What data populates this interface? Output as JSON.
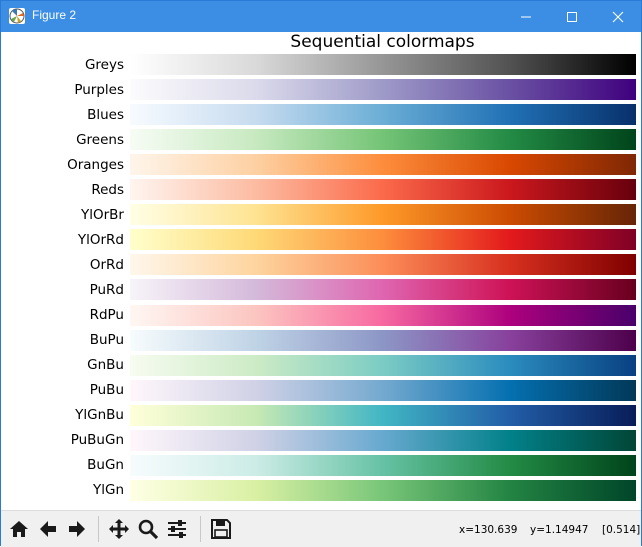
{
  "window": {
    "title": "Figure 2"
  },
  "figure": {
    "title": "Sequential colormaps"
  },
  "colormaps": [
    {
      "name": "Greys",
      "colors": [
        "#ffffff",
        "#d9d9d9",
        "#969696",
        "#525252",
        "#000000"
      ]
    },
    {
      "name": "Purples",
      "colors": [
        "#fcfbfd",
        "#dadaeb",
        "#9e9ac8",
        "#6a51a3",
        "#3f007d"
      ]
    },
    {
      "name": "Blues",
      "colors": [
        "#f7fbff",
        "#c6dbef",
        "#6baed6",
        "#2171b5",
        "#08306b"
      ]
    },
    {
      "name": "Greens",
      "colors": [
        "#f7fcf5",
        "#c7e9c0",
        "#74c476",
        "#238b45",
        "#00441b"
      ]
    },
    {
      "name": "Oranges",
      "colors": [
        "#fff5eb",
        "#fdd0a2",
        "#fd8d3c",
        "#d94801",
        "#7f2704"
      ]
    },
    {
      "name": "Reds",
      "colors": [
        "#fff5f0",
        "#fcbba1",
        "#fb6a4a",
        "#cb181d",
        "#67000d"
      ]
    },
    {
      "name": "YlOrBr",
      "colors": [
        "#ffffe5",
        "#fee391",
        "#fe9929",
        "#cc4c02",
        "#662506"
      ]
    },
    {
      "name": "YlOrRd",
      "colors": [
        "#ffffcc",
        "#fed976",
        "#fd8d3c",
        "#e31a1c",
        "#800026"
      ]
    },
    {
      "name": "OrRd",
      "colors": [
        "#fff7ec",
        "#fdd49e",
        "#fc8d59",
        "#d7301f",
        "#7f0000"
      ]
    },
    {
      "name": "PuRd",
      "colors": [
        "#f7f4f9",
        "#d4b9da",
        "#df65b0",
        "#ce1256",
        "#67001f"
      ]
    },
    {
      "name": "RdPu",
      "colors": [
        "#fff7f3",
        "#fcc5c0",
        "#f768a1",
        "#ae017e",
        "#49006a"
      ]
    },
    {
      "name": "BuPu",
      "colors": [
        "#f7fcfd",
        "#bfd3e6",
        "#8c96c6",
        "#88419d",
        "#4d004b"
      ]
    },
    {
      "name": "GnBu",
      "colors": [
        "#f7fcf0",
        "#ccebc5",
        "#7bccc4",
        "#2b8cbe",
        "#084081"
      ]
    },
    {
      "name": "PuBu",
      "colors": [
        "#fff7fb",
        "#d0d1e6",
        "#74a9cf",
        "#0570b0",
        "#023858"
      ]
    },
    {
      "name": "YlGnBu",
      "colors": [
        "#ffffd9",
        "#c7e9b4",
        "#41b6c4",
        "#225ea8",
        "#081d58"
      ]
    },
    {
      "name": "PuBuGn",
      "colors": [
        "#fff7fb",
        "#d0d1e6",
        "#67a9cf",
        "#02818a",
        "#014636"
      ]
    },
    {
      "name": "BuGn",
      "colors": [
        "#f7fcfd",
        "#ccece6",
        "#66c2a4",
        "#238b45",
        "#00441b"
      ]
    },
    {
      "name": "YlGn",
      "colors": [
        "#ffffe5",
        "#d9f0a3",
        "#78c679",
        "#238443",
        "#004529"
      ]
    }
  ],
  "toolbar": {
    "tools": [
      {
        "name": "home-button",
        "icon": "home-icon"
      },
      {
        "name": "back-button",
        "icon": "arrow-left-icon"
      },
      {
        "name": "forward-button",
        "icon": "arrow-right-icon"
      },
      {
        "name": "pan-button",
        "icon": "move-icon"
      },
      {
        "name": "zoom-button",
        "icon": "magnifier-icon"
      },
      {
        "name": "subplots-button",
        "icon": "sliders-icon"
      },
      {
        "name": "save-button",
        "icon": "floppy-disk-icon"
      }
    ],
    "x_readout": "x=130.639",
    "y_readout": "y=1.14947",
    "value_readout": "[0.514]"
  }
}
